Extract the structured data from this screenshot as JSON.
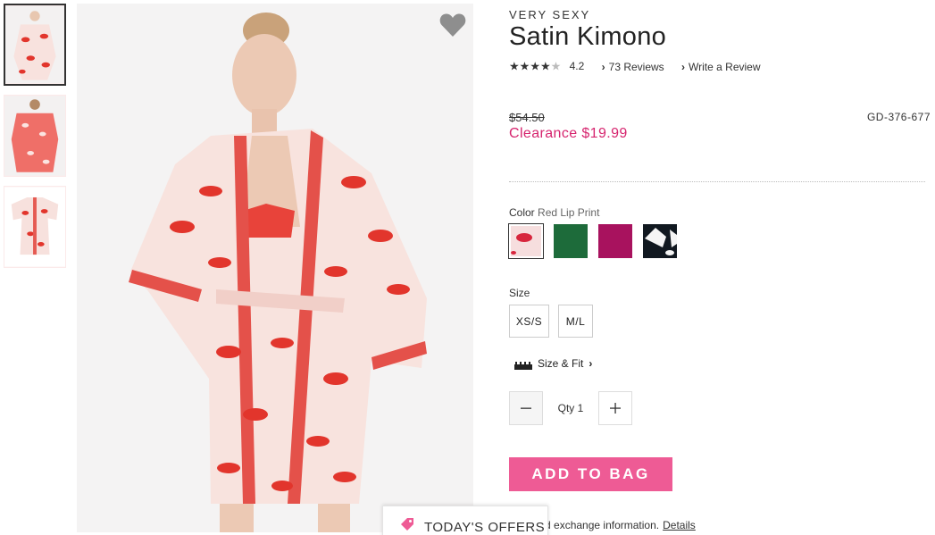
{
  "product": {
    "brand": "VERY SEXY",
    "title": "Satin Kimono",
    "rating": {
      "stars_filled": 4,
      "stars_total": 5,
      "value": "4.2"
    },
    "reviews_link": "73 Reviews",
    "write_review_link": "Write a Review",
    "original_price": "$54.50",
    "sale_price": "Clearance $19.99",
    "sku": "GD-376-677",
    "color": {
      "label": "Color",
      "selected": "Red Lip Print",
      "swatches": [
        {
          "name": "Red Lip Print",
          "color": "#f6dede"
        },
        {
          "name": "Green",
          "color": "#1d6b3a"
        },
        {
          "name": "Berry",
          "color": "#a8125e"
        },
        {
          "name": "Black Print",
          "color": "#111820"
        }
      ]
    },
    "size": {
      "label": "Size",
      "options": [
        "XS/S",
        "M/L"
      ]
    },
    "size_fit_link": "Size & Fit",
    "quantity": {
      "label": "Qty",
      "value": "1"
    },
    "add_to_bag": "ADD TO BAG",
    "returns_text": "urns and exchange information.",
    "returns_link": "Details"
  },
  "offers_tab": {
    "label": "TODAY'S OFFERS"
  },
  "icons": {
    "favorite": "heart-icon",
    "chevron": "chevron-right-icon",
    "ruler": "ruler-icon",
    "minus": "minus-icon",
    "plus": "plus-icon",
    "tag": "tag-icon"
  },
  "colors": {
    "accent_pink": "#ee5b95",
    "sale_red": "#d6246e"
  }
}
